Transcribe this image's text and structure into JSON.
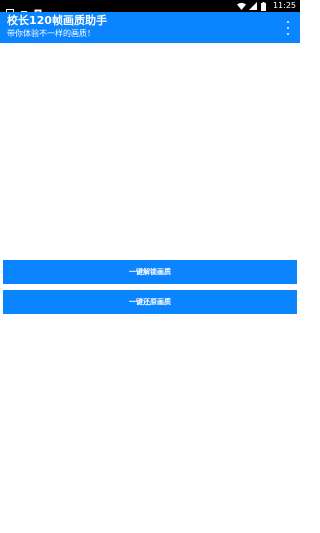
{
  "status_bar": {
    "time": "11:25",
    "left_icons": [
      "image-icon",
      "game-controller-icon",
      "app-notification-icon"
    ],
    "right_icons": [
      "wifi-icon",
      "signal-icon",
      "battery-icon"
    ]
  },
  "app_bar": {
    "title": "校长120帧画质助手",
    "subtitle": "带你体验不一样的画质！",
    "menu_icon": "overflow-menu-icon",
    "accent_color": "#0a84ff"
  },
  "actions": {
    "unlock_label": "一键解锁画质",
    "restore_label": "一键还原画质"
  }
}
